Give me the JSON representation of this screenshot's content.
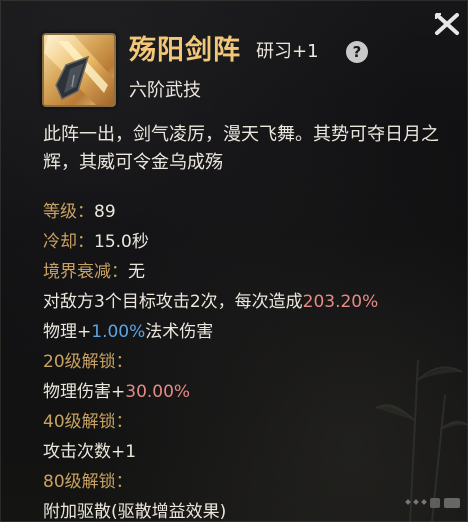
{
  "skill": {
    "icon": "sword-array-icon",
    "name": "殇阳剑阵",
    "level_tag": "研习+1",
    "tier": "六阶武技",
    "description": "此阵一出，剑气凌厉，漫天飞舞。其势可夺日月之辉，其威可令金乌成殇"
  },
  "stats": {
    "level_label": "等级：",
    "level_value": "89",
    "cooldown_label": "冷却：",
    "cooldown_value": "15.0秒",
    "decay_label": "境界衰减：",
    "decay_value": "无"
  },
  "effects": {
    "attack_prefix": "对敌方3个目标攻击2次，每次造成",
    "attack_value": "203.20%",
    "physical_prefix": "物理+",
    "physical_value": "1.00%",
    "physical_suffix": "法术伤害"
  },
  "unlocks": [
    {
      "label": "20级解锁：",
      "effect_prefix": "物理伤害+",
      "effect_value": "30.00%"
    },
    {
      "label": "40级解锁：",
      "effect_prefix": "攻击次数+1",
      "effect_value": ""
    },
    {
      "label": "80级解锁：",
      "effect_prefix": "附加驱散(驱散增益效果)",
      "effect_value": ""
    }
  ],
  "icons": {
    "help": "help-icon",
    "close": "close-icon",
    "help_glyph": "?"
  },
  "colors": {
    "title": "#f2c878",
    "label_gold": "#c9a261",
    "highlight_pink": "#e58b86",
    "highlight_blue": "#5fa3e6",
    "text": "#ece7dd"
  }
}
